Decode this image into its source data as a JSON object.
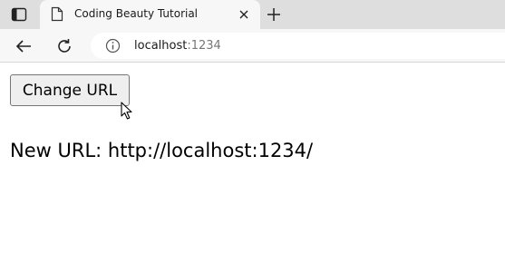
{
  "browser": {
    "tab": {
      "title": "Coding Beauty Tutorial"
    },
    "address_bar": {
      "host": "localhost",
      "port": ":1234"
    },
    "icons": {
      "sidebar": "sidebar-toggle-icon",
      "favicon": "page-icon",
      "close": "close-icon",
      "new_tab": "plus-icon",
      "back": "back-arrow-icon",
      "reload": "reload-icon",
      "info": "info-icon"
    }
  },
  "page": {
    "button_label": "Change URL",
    "status_prefix": "New URL:",
    "status_url": "http://localhost:1234/"
  }
}
